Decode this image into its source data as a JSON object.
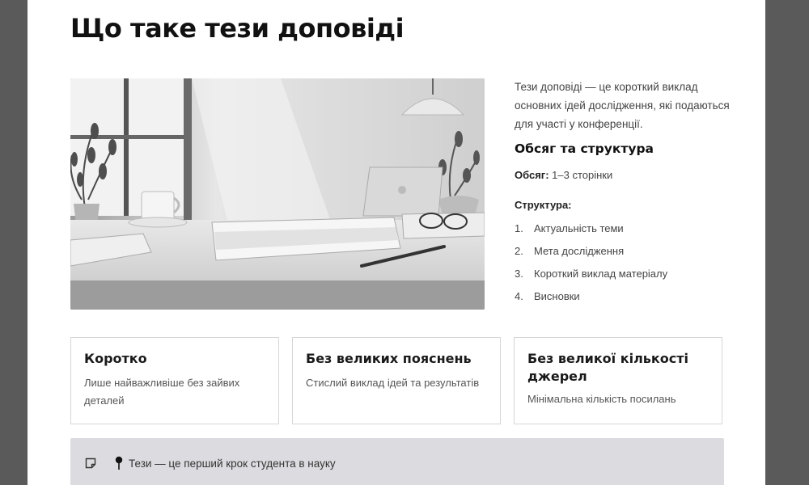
{
  "page": {
    "title": "Що таке тези доповіді"
  },
  "hero_image": {
    "description_icon": "desk-workspace-photo"
  },
  "intro": {
    "text": "Тези доповіді — це короткий виклад основних ідей дослідження, які подаються для участі у конференції."
  },
  "structure_section": {
    "heading": "Обсяг та структура",
    "volume_label": "Обсяг:",
    "volume_value": "1–3 сторінки",
    "structure_label": "Структура:",
    "items": [
      {
        "num": "1.",
        "label": "Актуальність теми"
      },
      {
        "num": "2.",
        "label": "Мета дослідження"
      },
      {
        "num": "3.",
        "label": "Короткий виклад матеріалу"
      },
      {
        "num": "4.",
        "label": "Висновки"
      }
    ]
  },
  "cards": [
    {
      "title": "Коротко",
      "text": "Лише найважливіше без зайвих деталей"
    },
    {
      "title": "Без великих пояснень",
      "text": "Стислий виклад ідей та результатів"
    },
    {
      "title": "Без великої кількості джерел",
      "text": "Мінімальна кількість посилань"
    }
  ],
  "banner": {
    "text": "Тези — це перший крок студента в науку",
    "icons": [
      "note-icon",
      "pin-icon"
    ]
  },
  "colors": {
    "frame": "#5a5a5a",
    "page": "#ffffff",
    "banner": "#dcdce0",
    "card_border": "#d6d6d6"
  }
}
